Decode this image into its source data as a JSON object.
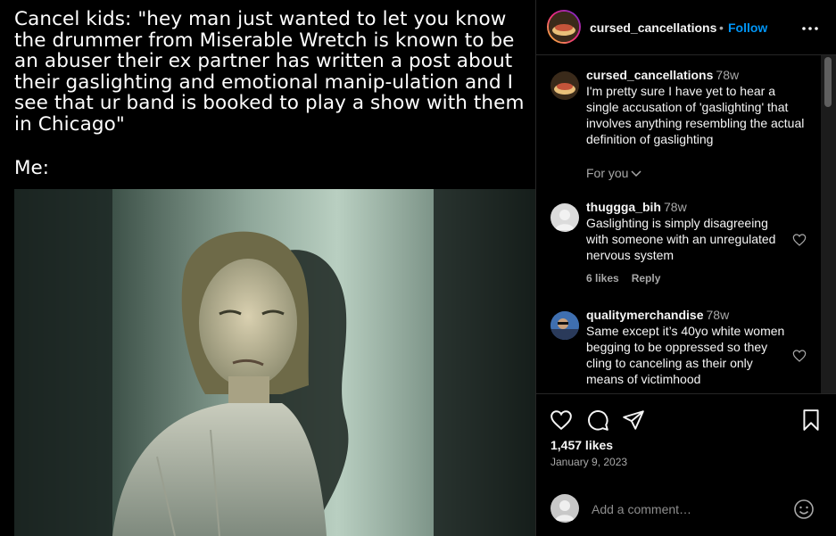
{
  "post": {
    "caption": "Cancel kids: \"hey man just wanted to let you know the drummer from Miserable Wretch is known to be an abuser their ex partner has written a post about their gaslighting and emotional manip-ulation and I see that ur band is booked to play a show with them in Chicago\"",
    "me_label": "Me:"
  },
  "header": {
    "username": "cursed_cancellations",
    "separator": "•",
    "follow_label": "Follow",
    "more_icon": "more-horizontal-icon"
  },
  "comments": [
    {
      "username": "cursed_cancellations",
      "time": "78w",
      "text": "I'm pretty sure I have yet to hear a single accusation of 'gaslighting' that involves anything resembling the actual definition of gaslighting"
    },
    {
      "username": "thuggga_bih",
      "time": "78w",
      "text": "Gaslighting is simply disagreeing with someone with an unregulated nervous system",
      "likes": "6 likes",
      "reply": "Reply"
    },
    {
      "username": "qualitymerchandise",
      "time": "78w",
      "text": "Same except it’s 40yo white women begging to be oppressed so they cling to canceling as their only means of victimhood"
    }
  ],
  "for_you_label": "For you",
  "actions": {
    "like_icon": "heart-icon",
    "comment_icon": "comment-icon",
    "share_icon": "share-icon",
    "save_icon": "bookmark-icon",
    "likes": "1,457 likes",
    "date": "January 9, 2023"
  },
  "comment_box": {
    "placeholder": "Add a comment…",
    "emoji_icon": "emoji-icon"
  },
  "colors": {
    "accent": "#0095f6",
    "background": "#000000",
    "secondary_text": "#a8a8a8"
  }
}
